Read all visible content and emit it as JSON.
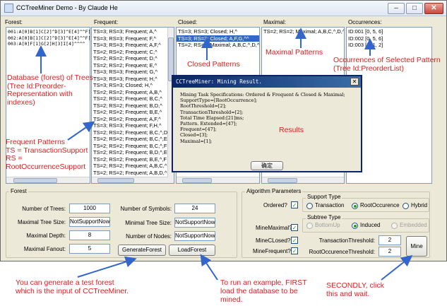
{
  "window": {
    "title": "CCTreeMiner Demo - By Claude He",
    "controls": [
      "–",
      "□",
      "✕"
    ]
  },
  "panels": {
    "forest": {
      "label": "Forest:",
      "rows": [
        "001:A[0]B[1]C[2]^D[3]^E[4]^^F[5]G",
        "002:A[0]B[1]C[2]^D[3]^E[4]^^F[5]G",
        "003:A[0]F[1]G[2]H[3]I[4]^^^^"
      ]
    },
    "frequent": {
      "label": "Frequent:",
      "rows": [
        "TS=3; RS=3; Frequent; A,^",
        "TS=3; RS=3; Frequent; F,^",
        "TS=3; RS=3; Frequent; A,F,^",
        "TS=2; RS=2; Frequent; C,^",
        "TS=2; RS=2; Frequent; D,^",
        "TS=2; RS=2; Frequent; E,^",
        "TS=3; RS=3; Frequent; G,^",
        "TS=3; RS=3; Frequent; H,^",
        "TS=3; RS=3; Closed; H,^",
        "TS=2; RS=2; Frequent; A,B,^",
        "TS=2; RS=2; Frequent; B,C,^",
        "TS=2; RS=2; Frequent; B,D,^",
        "TS=2; RS=2; Frequent; B,E,^",
        "TS=2; RS=2; Frequent; A,F,^",
        "TS=3; RS=3; Frequent; F,H,^",
        "TS=2; RS=2; Frequent; B,C,^,D",
        "TS=2; RS=2; Frequent; B,C,^,E",
        "TS=2; RS=2; Frequent; B,C,^,F",
        "TS=2; RS=2; Frequent; B,D,^,E",
        "TS=2; RS=2; Frequent; B,E,^,F",
        "TS=2; RS=2; Frequent; A,B,C,^",
        "TS=2; RS=2; Frequent; A,B,D,^",
        "TS=2; RS=2; Frequent; A,B,E,^"
      ]
    },
    "closed": {
      "label": "Closed:",
      "rows": [
        "TS=3; RS=3; Closed; H,^",
        "TS=3; RS=3; Closed; A,F,G,^^",
        "TS=2; RS=2; Maximal; A,B,C,^,D,^"
      ],
      "selected_index": 1
    },
    "maximal": {
      "label": "Maximal:",
      "rows": [
        "TS=2; RS=2; Maximal; A,B,C,^,D,^"
      ]
    },
    "occurrences": {
      "label": "Occurrences:",
      "rows": [
        "ID:001 [0, 5, 6]",
        "ID:002 [0, 5, 6]",
        "ID:003 [0, 1, 2]"
      ]
    }
  },
  "dialog": {
    "title": "CCTreeMiner: Mining Result.",
    "close": "✕",
    "lines": [
      "Mining Task Specifications: Ordered & Frequent & Closed & Maximal;",
      "SupportType=[RootOccurrence];",
      "RootThreshold=[2];",
      "TransactionThreshold=[2];",
      "Total Time Elapsed:[21]ms;",
      "Pattern. Extended=[47];",
      "Frequent=[47];",
      "Closed=[3];",
      "Maximal=[1];"
    ],
    "ok": "确定"
  },
  "forest_group": {
    "label": "Forest",
    "fields": {
      "number_of_trees": {
        "label": "Number of Trees:",
        "value": "1000"
      },
      "max_tree_size": {
        "label": "Maximal Tree Size:",
        "value": "NotSupportNow"
      },
      "max_depth": {
        "label": "Maximal Depth:",
        "value": "8"
      },
      "max_fanout": {
        "label": "Maximal Fanout:",
        "value": "5"
      },
      "number_of_symbols": {
        "label": "Number of Symbols:",
        "value": "24"
      },
      "min_tree_size": {
        "label": "Minimal Tree Size:",
        "value": "NotSupportNow"
      },
      "number_of_nodes": {
        "label": "Number of Nodes:",
        "value": "NotSupportNow"
      }
    },
    "generate_button": "GenerateForest",
    "load_button": "LoadForest"
  },
  "algo_group": {
    "label": "Algorithm Parameters",
    "ordered": "Ordered?",
    "mine_maximal": "MineMaximal?",
    "mine_closed": "MineCLosed?",
    "mine_frequent": "MineFrequent?",
    "support_type": {
      "label": "Support Type",
      "options": [
        "Transaction",
        "RootOccurence",
        "Hybrid"
      ],
      "selected": "RootOccurence"
    },
    "subtree_type": {
      "label": "Subtree Type",
      "options": [
        "BottomUp",
        "Induced",
        "Embedded"
      ],
      "selected": "Induced"
    },
    "transaction_threshold": {
      "label": "TransactionThreshold:",
      "value": "2"
    },
    "root_threshold": {
      "label": "RootOccurenceThreshold:",
      "value": "2"
    },
    "mine_button": "Mine"
  },
  "annotations": {
    "database": "Database (forest) of Trees (Tree Id:Preorder-Representation with indexes)",
    "database_l1": "Database (forest) of Trees",
    "database_l2": "(Tree Id:Preorder-",
    "database_l3": "Representation with",
    "database_l4": "indexes)",
    "frequent_l1": "Frequent Patterns",
    "frequent_l2": "TS = TransactionSupport",
    "frequent_l3": "RS =",
    "frequent_l4": "RootOccurrenceSupport",
    "closed": "Closed Patterns",
    "maximal": "Maximal Patterns",
    "results": "Results",
    "occ_l1": "Occurrences of Selected Pattern",
    "occ_l2": "(Tree Id:PreorderList)",
    "generate_l1": "You can generate a test forest",
    "generate_l2": "which is the input of CCTreeMiner.",
    "load_l1": "To run an example, FIRST",
    "load_l2": "load the database to be",
    "load_l3": "mined.",
    "mine_l1": "SECONDLY, click",
    "mine_l2": "this and wait."
  },
  "colors": {
    "annotation": "#e21d1d",
    "arrow": "#3366cc",
    "selection": "#316ac5",
    "checkmark": "#21a121"
  }
}
